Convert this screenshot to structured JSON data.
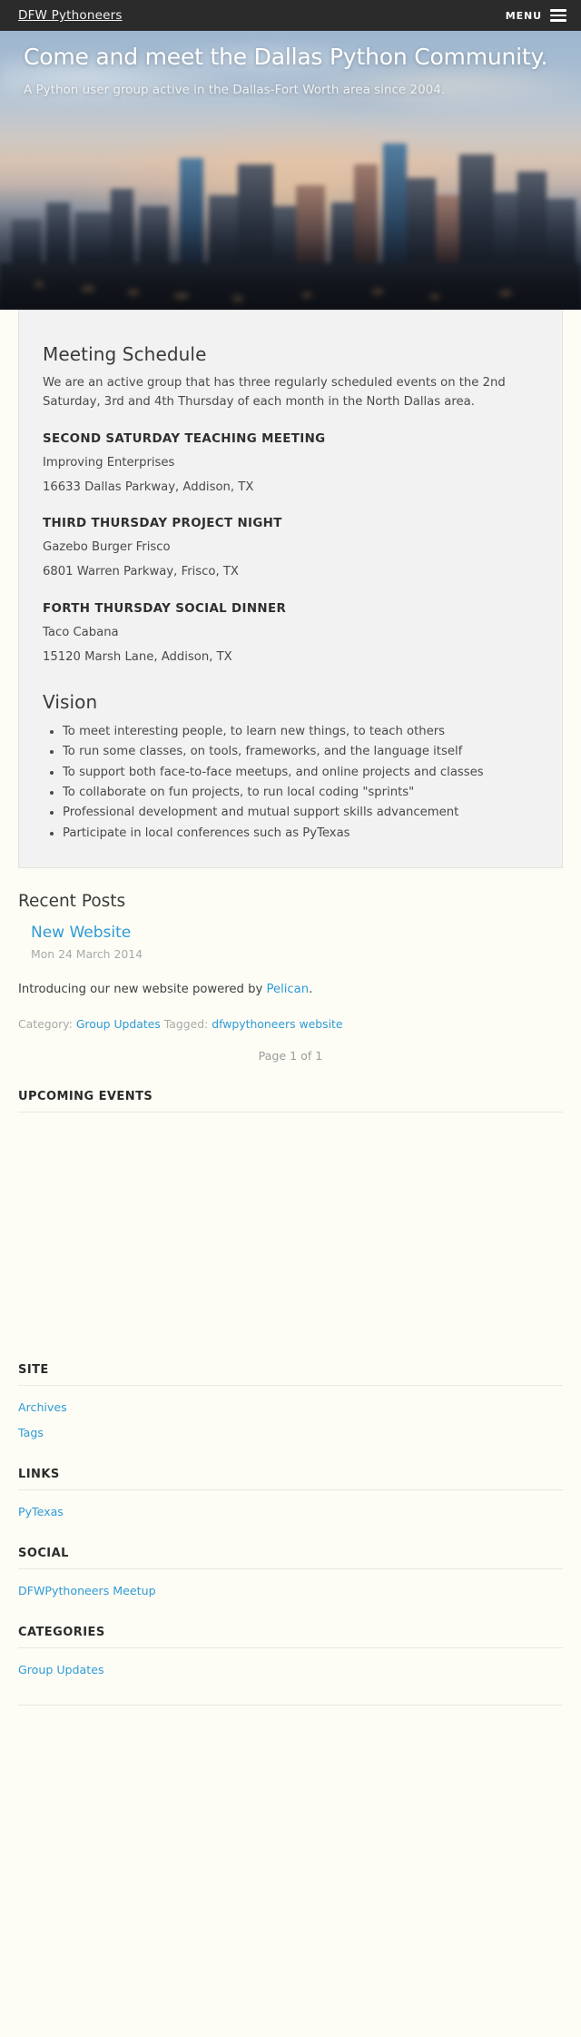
{
  "navbar": {
    "brand": "DFW Pythoneers",
    "menu_label": "MENU",
    "menu_icon": "hamburger-icon"
  },
  "hero": {
    "title": "Come and meet the Dallas Python Community.",
    "subtitle": "A Python user group active in the Dallas-Fort Worth area since 2004."
  },
  "schedule_panel": {
    "heading": "Meeting Schedule",
    "intro": "We are an active group that has three regularly scheduled events on the 2nd Saturday, 3rd and 4th Thursday of each month in the North Dallas area.",
    "meetings": [
      {
        "title": "SECOND SATURDAY TEACHING MEETING",
        "venue": "Improving Enterprises",
        "address": "16633 Dallas Parkway, Addison, TX"
      },
      {
        "title": "THIRD THURSDAY PROJECT NIGHT",
        "venue": "Gazebo Burger Frisco",
        "address": "6801 Warren Parkway, Frisco, TX"
      },
      {
        "title": "FORTH THURSDAY SOCIAL DINNER",
        "venue": "Taco Cabana",
        "address": "15120 Marsh Lane, Addison, TX"
      }
    ],
    "vision_heading": "Vision",
    "vision_items": [
      "To meet interesting people, to learn new things, to teach others",
      "To run some classes, on tools, frameworks, and the language itself",
      "To support both face-to-face meetups, and online projects and classes",
      "To collaborate on fun projects, to run local coding \"sprints\"",
      "Professional development and mutual support skills advancement",
      "Participate in local conferences such as PyTexas"
    ]
  },
  "recent_posts": {
    "heading": "Recent Posts",
    "post": {
      "title": "New Website",
      "date": "Mon 24 March 2014",
      "body_prefix": "Introducing our new website powered by ",
      "body_link": "Pelican",
      "body_suffix": ".",
      "category_label": "Category:",
      "category": "Group Updates",
      "tagged_label": "Tagged:",
      "tags": [
        "dfwpythoneers",
        "website"
      ]
    },
    "pagination": "Page 1 of 1"
  },
  "upcoming_events": {
    "title": "UPCOMING EVENTS",
    "items": []
  },
  "footer": {
    "sections": [
      {
        "title": "SITE",
        "links": [
          "Archives",
          "Tags"
        ]
      },
      {
        "title": "LINKS",
        "links": [
          "PyTexas"
        ]
      },
      {
        "title": "SOCIAL",
        "links": [
          "DFWPythoneers Meetup"
        ]
      },
      {
        "title": "CATEGORIES",
        "links": [
          "Group Updates"
        ]
      }
    ]
  },
  "colors": {
    "navbar_bg": "#2b2b2b",
    "link": "#2e9bd6",
    "panel_bg": "#f2f2f2",
    "page_bg": "#fdfdf6",
    "muted_text": "#a9a9a9"
  }
}
